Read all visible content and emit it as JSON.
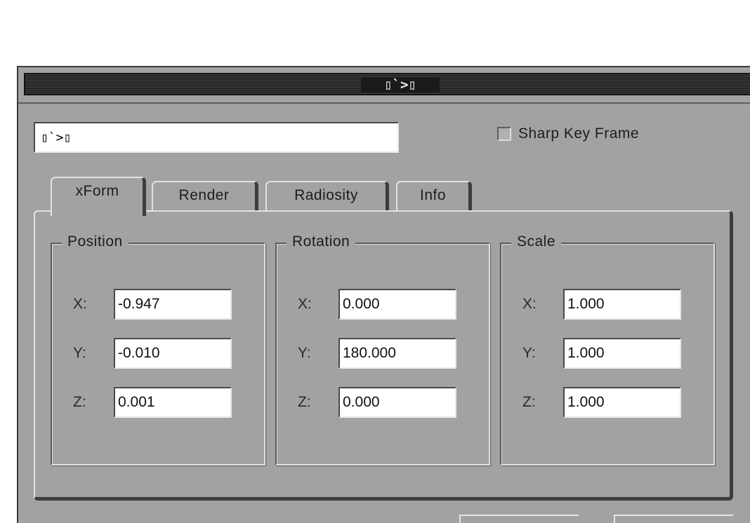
{
  "window": {
    "title": "▯`>▯"
  },
  "object_name": {
    "value": "▯`>▯"
  },
  "sharp_key_frame": {
    "label": "Sharp Key Frame",
    "checked": false
  },
  "tabs": [
    {
      "label": "xForm",
      "active": true
    },
    {
      "label": "Render",
      "active": false
    },
    {
      "label": "Radiosity",
      "active": false
    },
    {
      "label": "Info",
      "active": false
    }
  ],
  "groups": {
    "position": {
      "title": "Position",
      "x_label": "X:",
      "y_label": "Y:",
      "z_label": "Z:",
      "x": "-0.947",
      "y": "-0.010",
      "z": "0.001"
    },
    "rotation": {
      "title": "Rotation",
      "x_label": "X:",
      "y_label": "Y:",
      "z_label": "Z:",
      "x": "0.000",
      "y": "180.000",
      "z": "0.000"
    },
    "scale": {
      "title": "Scale",
      "x_label": "X:",
      "y_label": "Y:",
      "z_label": "Z:",
      "x": "1.000",
      "y": "1.000",
      "z": "1.000"
    }
  },
  "colors": {
    "dialog_background": "#a2a2a2",
    "titlebar": "#2c2c2c",
    "field_background": "#ffffff"
  }
}
